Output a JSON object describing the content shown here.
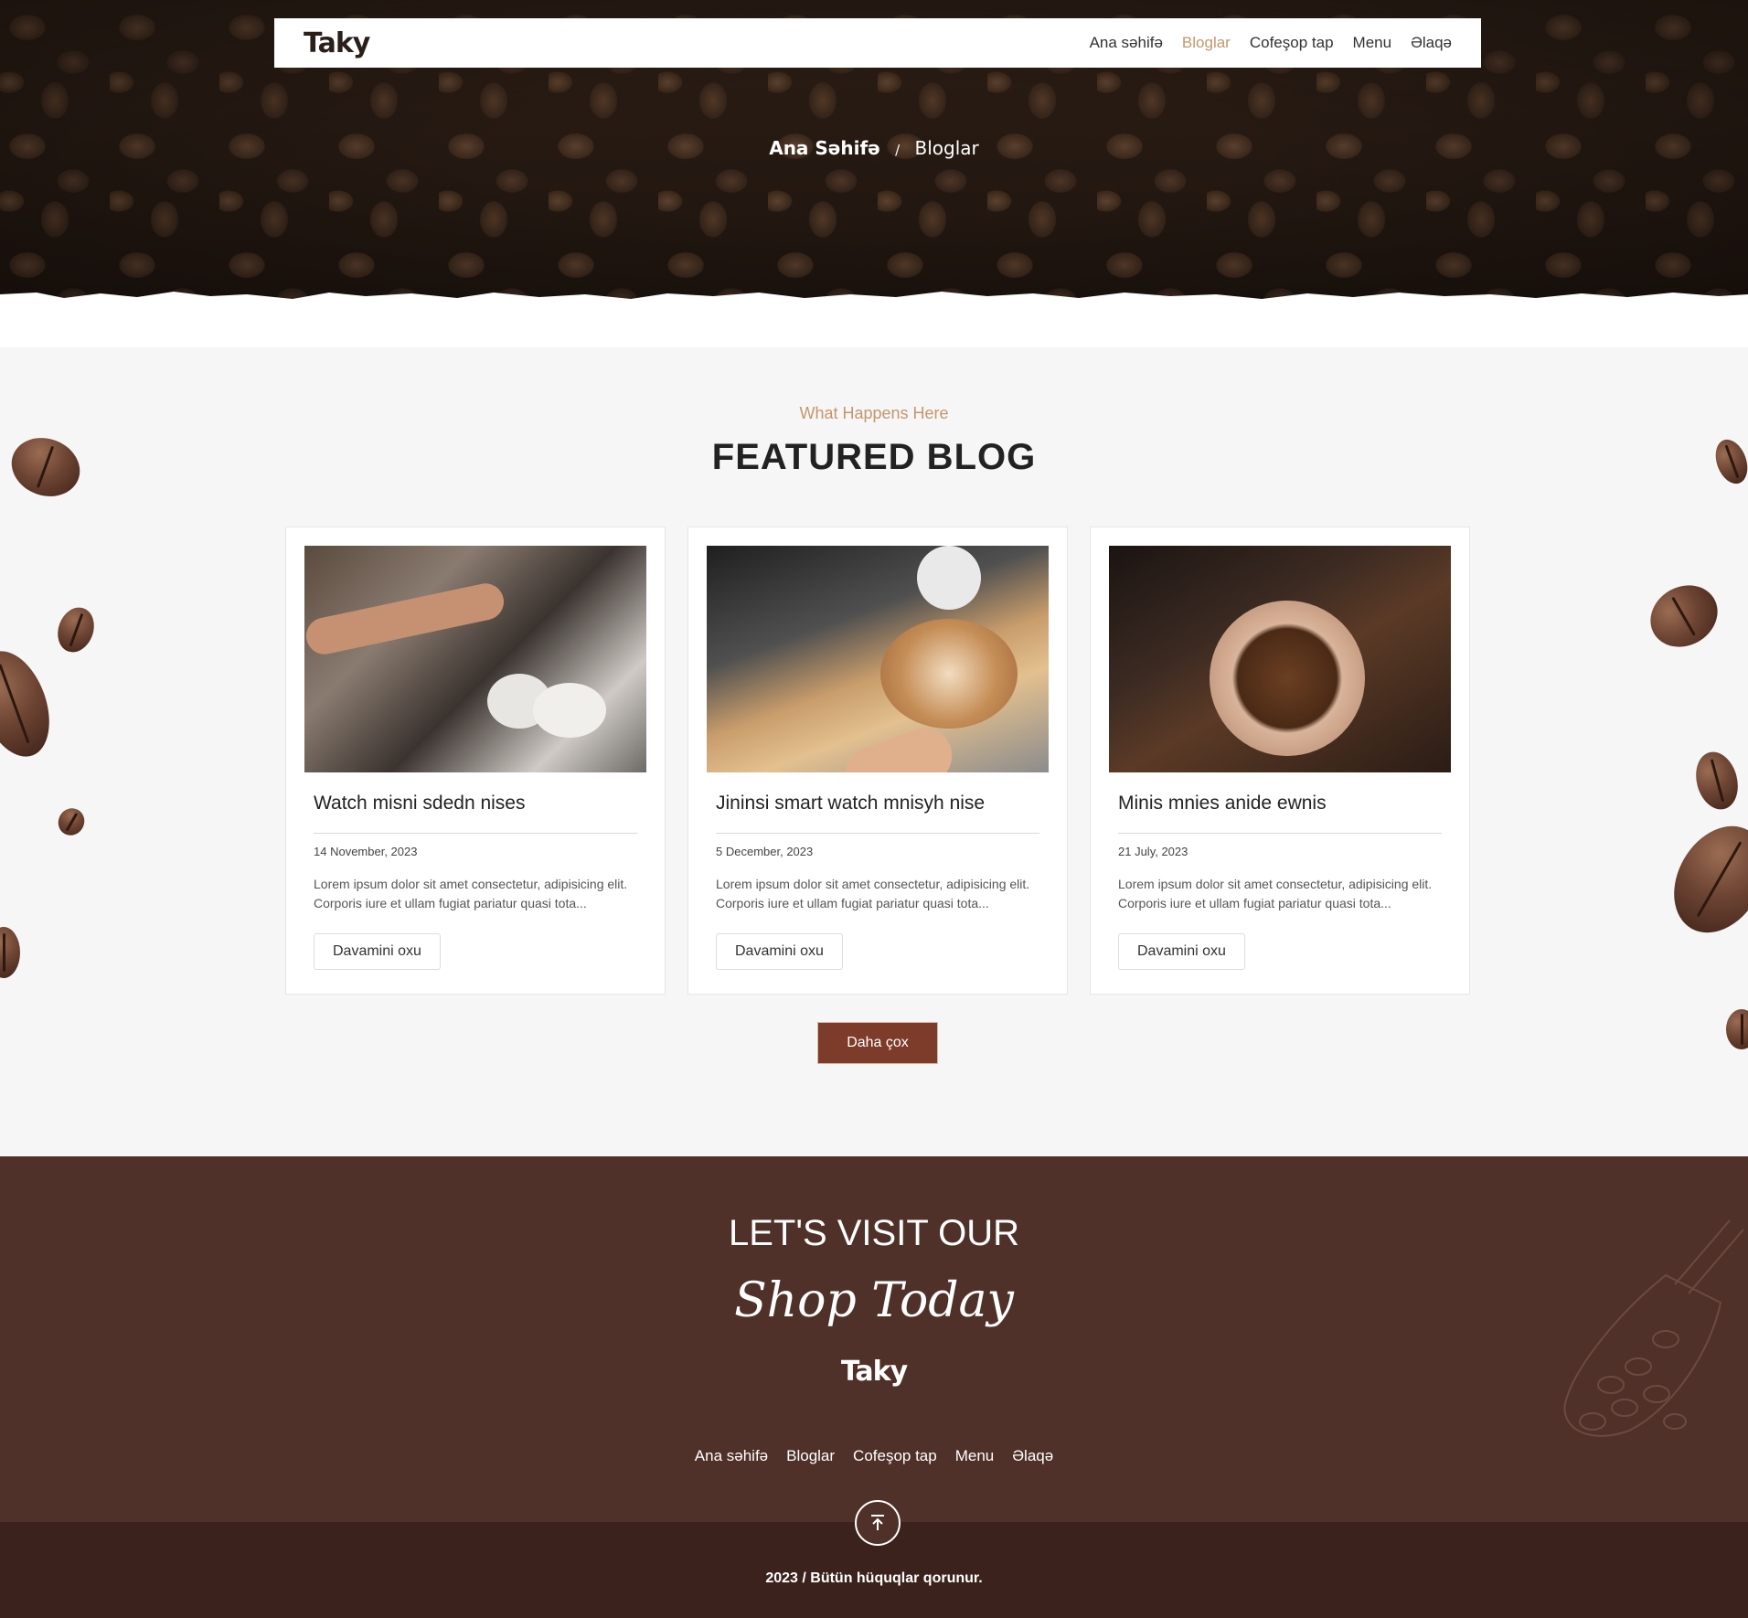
{
  "header": {
    "logo": "Taky",
    "nav": [
      {
        "label": "Ana səhifə",
        "active": false
      },
      {
        "label": "Bloglar",
        "active": true
      },
      {
        "label": "Cofeşop tap",
        "active": false
      },
      {
        "label": "Menu",
        "active": false
      },
      {
        "label": "Əlaqə",
        "active": false
      }
    ]
  },
  "breadcrumb": {
    "home": "Ana Səhifə",
    "separator": "/",
    "current": "Bloglar"
  },
  "blog": {
    "eyebrow": "What Happens Here",
    "title": "FEATURED BLOG",
    "cards": [
      {
        "title": "Watch misni sdedn nises",
        "date": "14 November, 2023",
        "excerpt": "Lorem ipsum dolor sit amet consectetur, adipisicing elit. Corporis iure et ullam fugiat pariatur quasi tota...",
        "button": "Davamini oxu"
      },
      {
        "title": "Jininsi smart watch mnisyh nise",
        "date": "5 December, 2023",
        "excerpt": "Lorem ipsum dolor sit amet consectetur, adipisicing elit. Corporis iure et ullam fugiat pariatur quasi tota...",
        "button": "Davamini oxu"
      },
      {
        "title": "Minis mnies anide ewnis",
        "date": "21 July, 2023",
        "excerpt": "Lorem ipsum dolor sit amet consectetur, adipisicing elit. Corporis iure et ullam fugiat pariatur quasi tota...",
        "button": "Davamini oxu"
      }
    ],
    "more_button": "Daha çox"
  },
  "footer": {
    "heading": "LET'S VISIT OUR",
    "script": "Shop Today",
    "logo": "Taky",
    "links": [
      "Ana səhifə",
      "Bloglar",
      "Cofeşop tap",
      "Menu",
      "Əlaqə"
    ],
    "copyright": "2023 / Bütün hüquqlar qorunur."
  },
  "colors": {
    "accent": "#c4966c",
    "button": "#7d3b2a",
    "footer": "#4f3129",
    "footer_bottom": "#3b221c"
  }
}
